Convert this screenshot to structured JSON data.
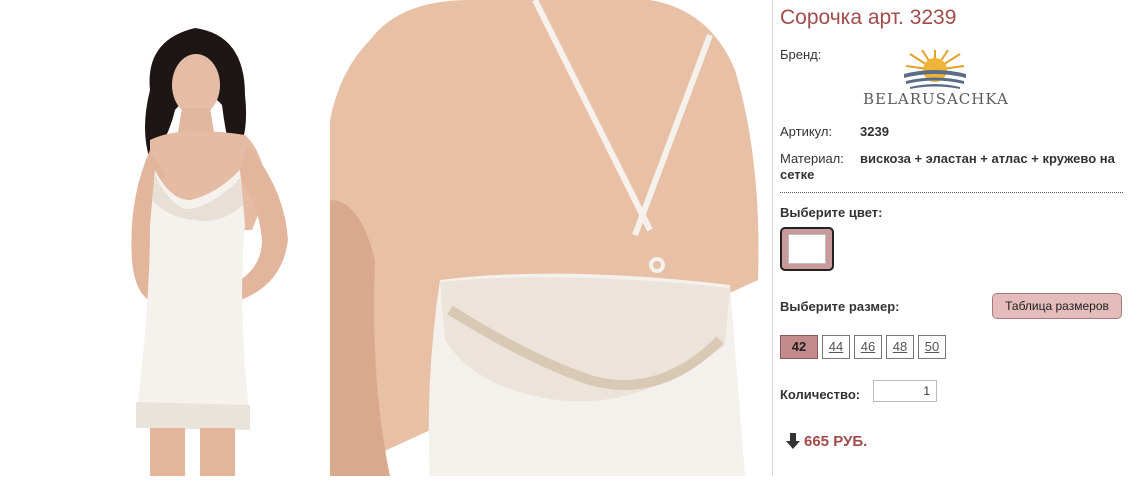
{
  "product": {
    "title": "Сорочка арт. 3239",
    "brand_label": "Бренд:",
    "brand_name": "BELARUSACHKA",
    "sku_label": "Артикул:",
    "sku_value": "3239",
    "material_label": "Материал:",
    "material_value": "вискоза + эластан + атлас + кружево на сетке"
  },
  "color": {
    "label": "Выберите цвет:",
    "swatch": "#ffffff"
  },
  "size": {
    "label": "Выберите размер:",
    "table_button": "Таблица размеров",
    "options": [
      "42",
      "44",
      "46",
      "48",
      "50"
    ],
    "selected": "42"
  },
  "quantity": {
    "label": "Количество:",
    "value": "1"
  },
  "price": {
    "value": "665 РУБ."
  },
  "icons": {
    "price_arrow": "arrow-down-icon",
    "logo": "sun-logo-icon"
  },
  "colors": {
    "accent": "#a24b4b",
    "button_bg": "#e5bcbc",
    "selected_size_bg": "#c38b8b"
  }
}
